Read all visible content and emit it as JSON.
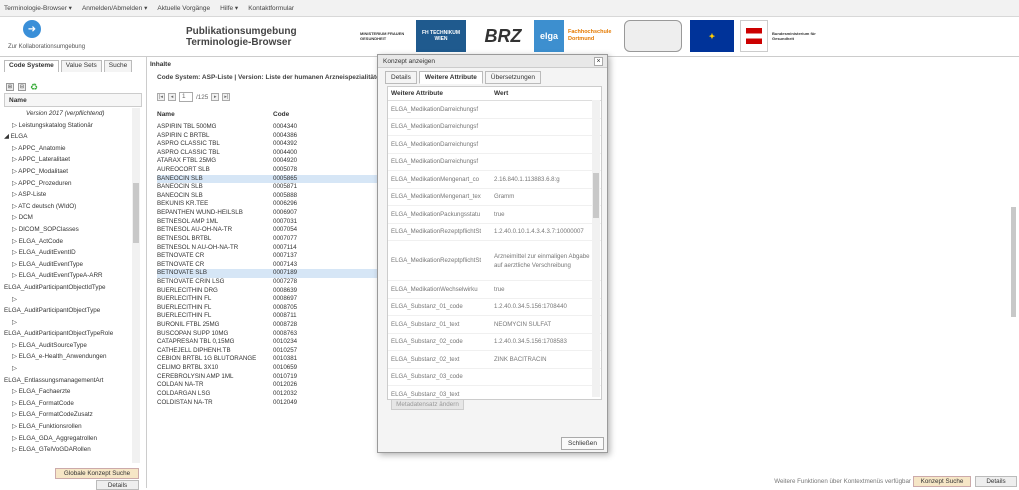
{
  "topbar": {
    "items": [
      "Terminologie-Browser ▾",
      "Anmelden/Abmelden ▾",
      "Aktuelle Vorgänge",
      "Hilfe ▾",
      "Kontaktformular"
    ]
  },
  "header": {
    "collab_label": "Zur Kollaborationsumgebung",
    "pub_line1": "Publikationsumgebung",
    "pub_line2": "Terminologie-Browser",
    "logos": {
      "ministerium": "MINISTERIUM FRAUEN GESUNDHEIT",
      "fh": "FH TECHNIKUM WIEN",
      "brz": "BRZ",
      "elga": "elga",
      "fhd": "Fachhochschule Dortmund",
      "bmg": "Bundesministerium für Gesundheit"
    }
  },
  "left": {
    "tabs": [
      "Code Systeme",
      "Value Sets",
      "Suche"
    ],
    "name_header": "Name",
    "tree": [
      "Version 2017 (verpflichtend)",
      "▷ Leistungskatalog Stationär",
      "◢ ELGA",
      "▷ APPC_Anatomie",
      "▷ APPC_Lateralitaet",
      "▷ APPC_Modalitaet",
      "▷ APPC_Prozeduren",
      "▷ ASP-Liste",
      "▷ ATC deutsch (WIdO)",
      "▷ DCM",
      "▷ DICOM_SOPClasses",
      "▷ ELGA_ActCode",
      "▷ ELGA_AuditEventID",
      "▷ ELGA_AuditEventType",
      "▷ ELGA_AuditEventTypeA-ARR",
      "ELGA_AuditParticipantObjectIdType",
      "▷",
      "ELGA_AuditParticipantObjectType",
      "▷",
      "ELGA_AuditParticipantObjectTypeRole",
      "▷ ELGA_AuditSourceType",
      "▷ ELGA_e-Health_Anwendungen",
      "▷",
      "ELGA_EntlassungsmanagementArt",
      "▷ ELGA_Fachaerzte",
      "▷ ELGA_FormatCode",
      "▷ ELGA_FormatCodeZusatz",
      "▷ ELGA_Funktionsrollen",
      "▷ ELGA_GDA_Aggregatrollen",
      "▷ ELGA_GTelVoGDARollen"
    ],
    "global_btn": "Globale Konzept Suche",
    "details_btn": "Details"
  },
  "main": {
    "inhalte": "Inhalte",
    "codesystem": "Code System: ASP-Liste | Version: Liste der humanen Arzneispezialitäten (",
    "pager": {
      "page": "1",
      "total": "/125"
    },
    "headers": [
      "Name",
      "Code"
    ],
    "rows": [
      [
        "ASPIRIN TBL 500MG",
        "0004340"
      ],
      [
        "ASPIRIN C BRTBL",
        "0004386"
      ],
      [
        "ASPRO CLASSIC TBL",
        "0004392"
      ],
      [
        "ASPRO CLASSIC TBL",
        "0004400"
      ],
      [
        "ATARAX FTBL 25MG",
        "0004920"
      ],
      [
        "AUREOCORT SLB",
        "0005078"
      ],
      [
        "BANEOCIN SLB",
        "0005865"
      ],
      [
        "BANEOCIN SLB",
        "0005871"
      ],
      [
        "BANEOCIN SLB",
        "0005888"
      ],
      [
        "BEKUNIS KR.TEE",
        "0006296"
      ],
      [
        "BEPANTHEN WUND-HEILSLB",
        "0006907"
      ],
      [
        "BETNESOL AMP 1ML",
        "0007031"
      ],
      [
        "BETNESOL AU-OH-NA-TR",
        "0007054"
      ],
      [
        "BETNESOL BRTBL",
        "0007077"
      ],
      [
        "BETNESOL N AU-OH-NA-TR",
        "0007114"
      ],
      [
        "BETNOVATE CR",
        "0007137"
      ],
      [
        "BETNOVATE CR",
        "0007143"
      ],
      [
        "BETNOVATE SLB",
        "0007189"
      ],
      [
        "BETNOVATE CRIN LSG",
        "0007278"
      ],
      [
        "BUERLECITHIN DRG",
        "0008639"
      ],
      [
        "BUERLECITHIN FL",
        "0008697"
      ],
      [
        "BUERLECITHIN FL",
        "0008705"
      ],
      [
        "BUERLECITHIN FL",
        "0008711"
      ],
      [
        "BURONIL FTBL 25MG",
        "0008728"
      ],
      [
        "BUSCOPAN SUPP 10MG",
        "0008763"
      ],
      [
        "CATAPRESAN TBL 0,15MG",
        "0010234"
      ],
      [
        "CATHEJELL DIPHENH.TB",
        "0010257"
      ],
      [
        "CEBION BRTBL 1G BLUTORANGE",
        "0010381"
      ],
      [
        "CELIMO BRTBL 3X10",
        "0010659"
      ],
      [
        "CEREBROLYSIN AMP 1ML",
        "0010719"
      ],
      [
        "COLDAN NA-TR",
        "0012026"
      ],
      [
        "COLDARGAN LSG",
        "0012032"
      ],
      [
        "COLDISTAN NA-TR",
        "0012049"
      ]
    ],
    "selected": [
      6,
      17
    ],
    "bottom_text": "Weitere Funktionen über Kontextmenüs verfügbar",
    "konzept_btn": "Konzept Suche",
    "details_btn": "Details"
  },
  "modal": {
    "title": "Konzept anzeigen",
    "close": "×",
    "tabs": [
      "Details",
      "Weitere Attribute",
      "Übersetzungen"
    ],
    "headers": [
      "Weitere Attribute",
      "Wert"
    ],
    "rows": [
      [
        "ELGA_MedikationDarreichungsf",
        ""
      ],
      [
        "ELGA_MedikationDarreichungsf",
        ""
      ],
      [
        "ELGA_MedikationDarreichungsf",
        ""
      ],
      [
        "ELGA_MedikationDarreichungsf",
        ""
      ],
      [
        "ELGA_MedikationMengenart_co",
        "2.16.840.1.113883.6.8:g"
      ],
      [
        "ELGA_MedikationMengenart_tex",
        "Gramm"
      ],
      [
        "ELGA_MedikationPackungsstatu",
        "true"
      ],
      [
        "ELGA_MedikationRezeptpflichtSt",
        "1.2.40.0.10.1.4.3.4.3.7:10000007"
      ],
      [
        "ELGA_MedikationRezeptpflichtSt",
        "Arzneimittel zur einmaligen Abgabe auf aerztliche Verschreibung"
      ],
      [
        "ELGA_MedikationWechselwirku",
        "true"
      ],
      [
        "ELGA_Substanz_01_code",
        "1.2.40.0.34.5.156:1708440"
      ],
      [
        "ELGA_Substanz_01_text",
        "NEOMYCIN SULFAT"
      ],
      [
        "ELGA_Substanz_02_code",
        "1.2.40.0.34.5.156:1708583"
      ],
      [
        "ELGA_Substanz_02_text",
        "ZINK BACITRACIN"
      ],
      [
        "ELGA_Substanz_03_code",
        ""
      ],
      [
        "ELGA_Substanz_03_text",
        ""
      ]
    ],
    "meta_btn": "Metadatensatz ändern",
    "close_btn": "Schließen"
  }
}
